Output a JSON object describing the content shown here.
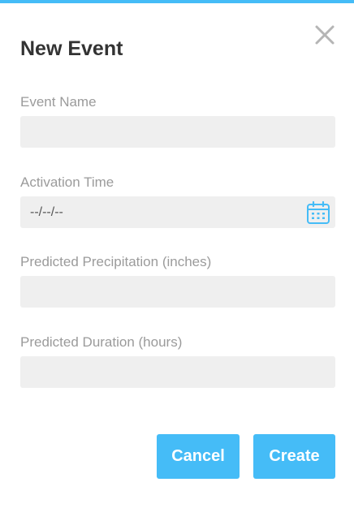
{
  "dialog": {
    "title": "New Event",
    "accent_color": "#45bcf7",
    "close_icon": "close-icon"
  },
  "fields": {
    "event_name": {
      "label": "Event Name",
      "value": ""
    },
    "activation_time": {
      "label": "Activation Time",
      "value": "--/--/--",
      "icon": "calendar-icon"
    },
    "precipitation": {
      "label": "Predicted Precipitation (inches)",
      "value": ""
    },
    "duration": {
      "label": "Predicted Duration (hours)",
      "value": ""
    }
  },
  "actions": {
    "cancel_label": "Cancel",
    "create_label": "Create"
  }
}
